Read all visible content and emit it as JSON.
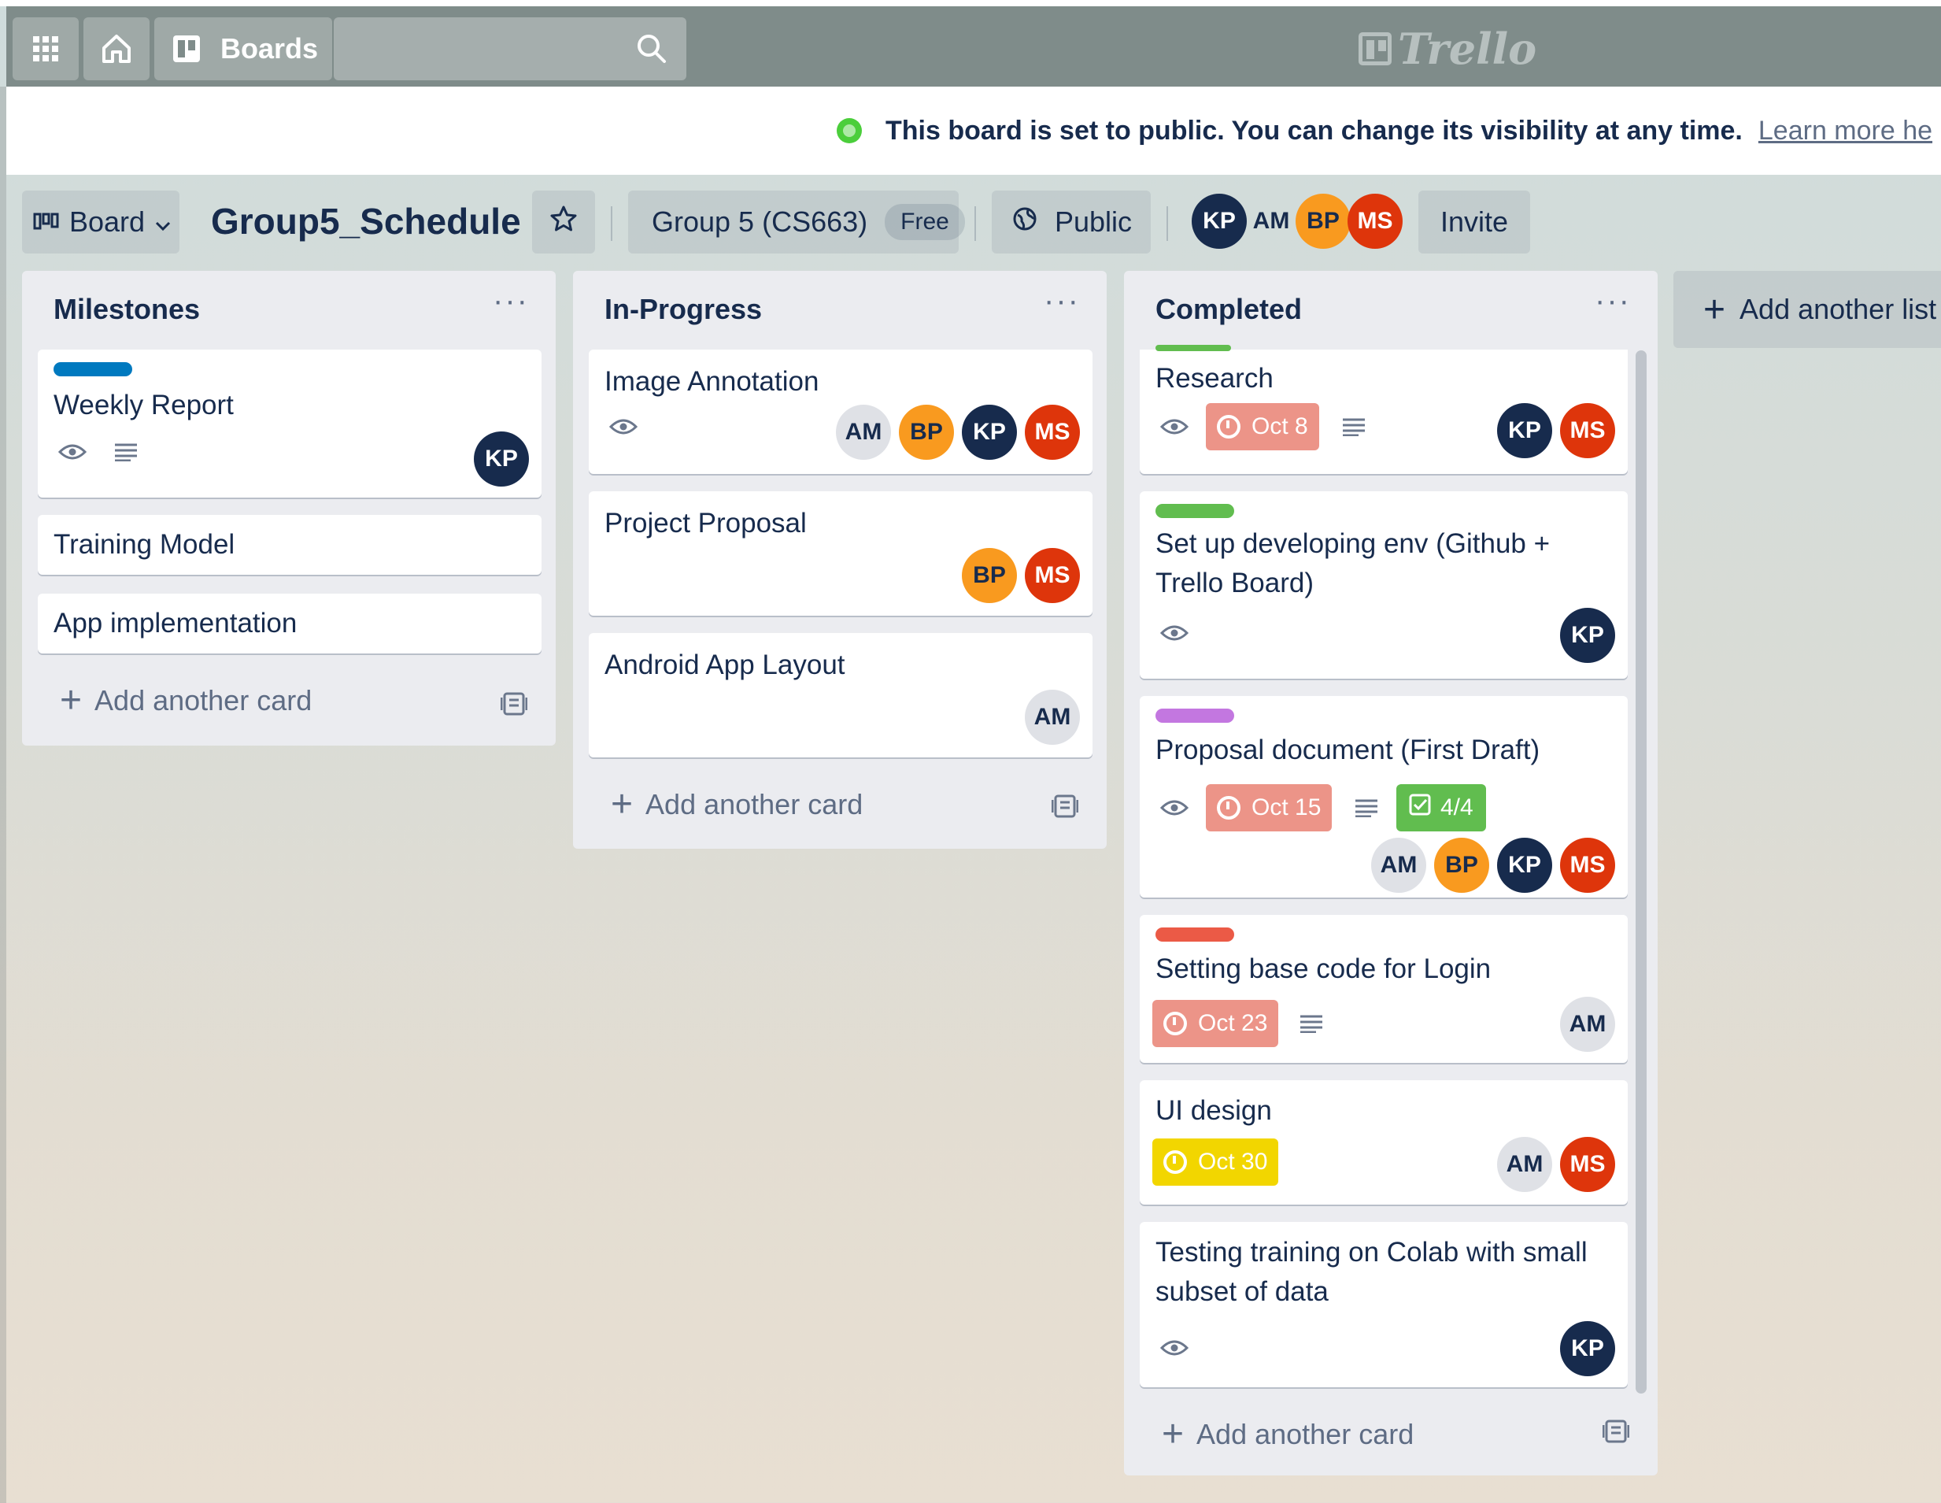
{
  "navbar": {
    "boards_label": "Boards",
    "logo_text": "Trello",
    "icons": [
      "apps-grid-icon",
      "home-icon",
      "boards-icon",
      "search-icon"
    ]
  },
  "banner": {
    "message": "This board is set to public. You can change its visibility at any time.",
    "link": "Learn more he"
  },
  "boardbar": {
    "view_label": "Board",
    "title": "Group5_Schedule",
    "team": "Group 5 (CS663)",
    "team_badge": "Free",
    "visibility": "Public",
    "members": [
      "KP",
      "AM",
      "BP",
      "MS"
    ],
    "invite_label": "Invite"
  },
  "colors": {
    "label_blue": "#0079bf",
    "label_green": "#61bd4f",
    "label_purple": "#c377e0",
    "label_red": "#eb5a46",
    "due_red": "#ec9488",
    "due_yellow": "#f2d600",
    "avatar_kp": "#172b4d",
    "avatar_am": "#dfe1e6",
    "avatar_bp": "#f99a1f",
    "avatar_ms": "#de350b"
  },
  "lists": [
    {
      "title": "Milestones",
      "menu": "···",
      "cards": [
        {
          "title": "Weekly Report",
          "label": "blue",
          "members": [
            "KP"
          ]
        },
        {
          "title": "Training Model"
        },
        {
          "title": "App implementation"
        }
      ],
      "add_card": "Add another card"
    },
    {
      "title": "In-Progress",
      "menu": "···",
      "cards": [
        {
          "title": "Image Annotation",
          "members": [
            "AM",
            "BP",
            "KP",
            "MS"
          ]
        },
        {
          "title": "Project Proposal",
          "members": [
            "BP",
            "MS"
          ]
        },
        {
          "title": "Android App Layout",
          "members": [
            "AM"
          ]
        }
      ],
      "add_card": "Add another card"
    },
    {
      "title": "Completed",
      "menu": "···",
      "cards": [
        {
          "title": "Research",
          "due": "Oct 8",
          "members": [
            "KP",
            "MS"
          ]
        },
        {
          "title_line1": "Set up developing env (Github +",
          "title_line2": "Trello Board)",
          "label": "green",
          "members": [
            "KP"
          ]
        },
        {
          "title": "Proposal document (First Draft)",
          "label": "purple",
          "due": "Oct 15",
          "checklist": "4/4",
          "members": [
            "AM",
            "BP",
            "KP",
            "MS"
          ]
        },
        {
          "title": "Setting base code for Login",
          "label": "red",
          "due": "Oct 23",
          "members": [
            "AM"
          ]
        },
        {
          "title": "UI design",
          "due": "Oct 30",
          "members": [
            "AM",
            "MS"
          ]
        },
        {
          "title_line1": "Testing training on Colab with small",
          "title_line2": "subset of data",
          "members": [
            "KP"
          ]
        }
      ],
      "add_card": "Add another card"
    }
  ],
  "add_list": "Add another list"
}
